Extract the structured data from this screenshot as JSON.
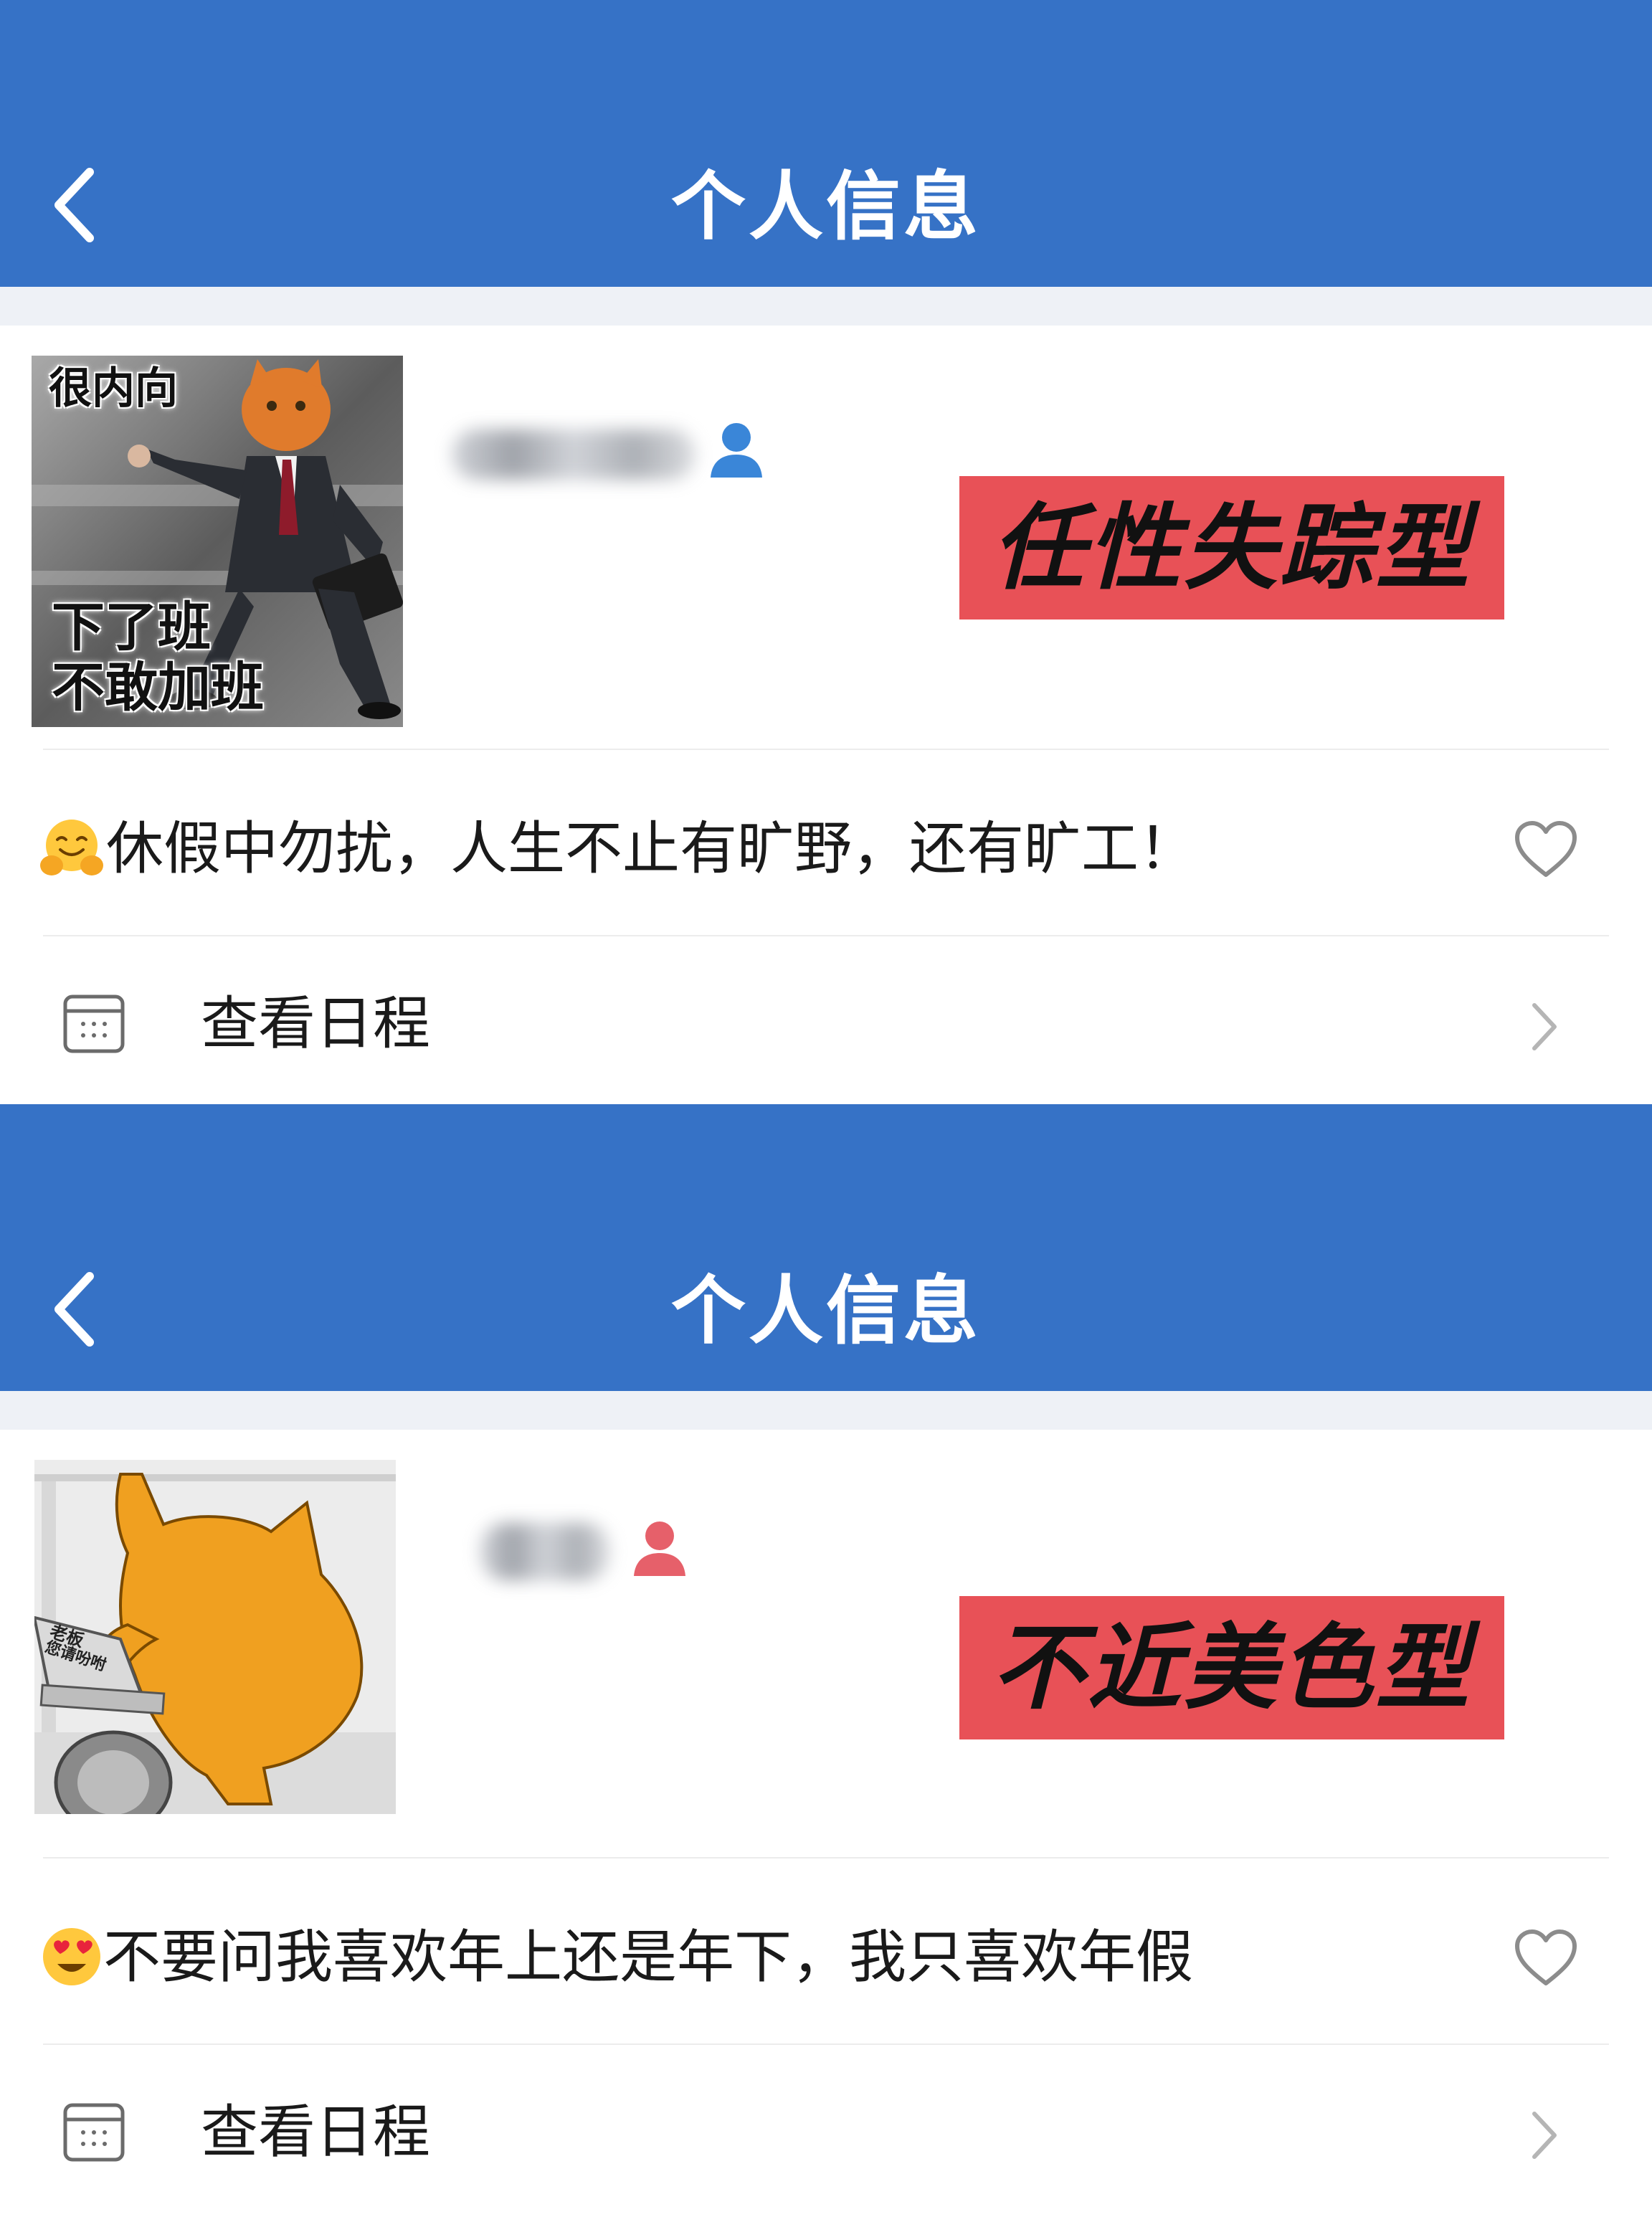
{
  "panels": [
    {
      "header": {
        "title": "个人信息"
      },
      "avatar": {
        "caption_top": "很内向",
        "caption_bottom_1": "下了班",
        "caption_bottom_2": "不敢加班"
      },
      "tag": "任性失踪型",
      "status_text": "休假中勿扰，人生不止有旷野，还有旷工！",
      "schedule_label": "查看日程",
      "user_icon_color": "#3a86d8"
    },
    {
      "header": {
        "title": "个人信息"
      },
      "avatar": {
        "caption_1": "老板",
        "caption_2": "您请吩咐"
      },
      "tag": "不近美色型",
      "status_text": "不要问我喜欢年上还是年下，我只喜欢年假",
      "schedule_label": "查看日程",
      "user_icon_color": "#e6606a"
    }
  ],
  "colors": {
    "header_bg": "#3672c6",
    "tag_bg": "#e85157",
    "gap_bg": "#eef1f6"
  }
}
